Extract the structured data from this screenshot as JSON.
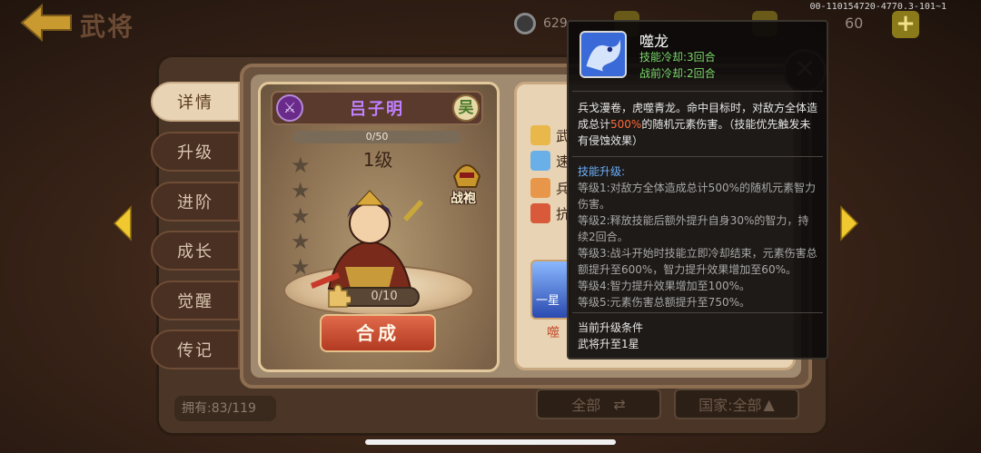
{
  "header": {
    "title": "武将",
    "coins": "629",
    "energy": "60",
    "version": "00-110154720-4770.3-101~1"
  },
  "tabs": [
    {
      "label": "详情",
      "active": true
    },
    {
      "label": "升级",
      "active": false
    },
    {
      "label": "进阶",
      "active": false
    },
    {
      "label": "成长",
      "active": false
    },
    {
      "label": "觉醒",
      "active": false
    },
    {
      "label": "传记",
      "active": false
    }
  ],
  "hero": {
    "name": "吕子明",
    "faction": "吴",
    "exp": "0/50",
    "level": "1级",
    "equipment_label": "战袍",
    "shards": "0/10",
    "compose_label": "合成"
  },
  "attributes": {
    "rows": [
      "武",
      "速",
      "兵",
      "抗"
    ],
    "skill_thumb_label": "一星",
    "skill_name": "噬"
  },
  "footer": {
    "owned": "拥有:83/119",
    "filter_all": "全部",
    "filter_country": "国家:全部"
  },
  "tooltip": {
    "name": "噬龙",
    "cooldown_skill": "技能冷却:3回合",
    "cooldown_prebattle": "战前冷却:2回合",
    "desc_before": "兵戈漫卷，虎噬青龙。命中目标时，对敌方全体造成总计",
    "desc_highlight": "500%",
    "desc_after": "的随机元素伤害。（技能优先触发未有侵蚀效果）",
    "upgrade_title": "技能升级:",
    "levels": [
      "等级1:对敌方全体造成总计500%的随机元素智力伤害。",
      "等级2:释放技能后额外提升自身30%的智力，持续2回合。",
      "等级3:战斗开始时技能立即冷却结束，元素伤害总额提升至600%，智力提升效果增加至60%。",
      "等级4:智力提升效果增加至100%。",
      "等级5:元素伤害总额提升至750%。"
    ],
    "condition_title": "当前升级条件",
    "condition_value": "武将升至1星"
  },
  "colors": {
    "tab_active_bg": "#e8d4b4",
    "name_purple": "#c080ff",
    "cooldown_green": "#7ad86a",
    "upgrade_blue": "#6ab0ff",
    "highlight_orange": "#ff6a3a",
    "compose_red": "#b23a22"
  },
  "icons": {
    "back": "back-arrow-icon",
    "coin": "coin-icon",
    "class": "sword-class-icon",
    "robe": "helmet-robe-icon",
    "shard": "puzzle-shard-icon",
    "close": "close-icon",
    "skill": "dragon-skill-icon",
    "swap": "swap-arrows-icon",
    "sort": "triangle-up-icon"
  }
}
